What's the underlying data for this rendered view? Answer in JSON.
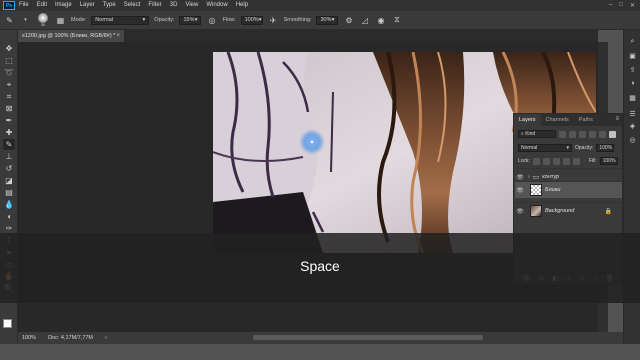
{
  "menu": {
    "logo": "Ps",
    "items": [
      "File",
      "Edit",
      "Image",
      "Layer",
      "Type",
      "Select",
      "Filter",
      "3D",
      "View",
      "Window",
      "Help"
    ],
    "window_controls": [
      "–",
      "□",
      "✕"
    ]
  },
  "options": {
    "brush_size": "30",
    "mode_label": "Mode:",
    "mode_value": "Normal",
    "opacity_label": "Opacity:",
    "opacity_value": "15%",
    "flow_label": "Flow:",
    "flow_value": "100%",
    "smoothing_label": "Smoothing:",
    "smoothing_value": "30%"
  },
  "document": {
    "tab_title": "s1200.jpg @ 100% (Блики, RGB/8#) *",
    "close": "×",
    "zoom": "100%",
    "doc_info": "Doc: 4,17M/7,77M"
  },
  "layers_panel": {
    "tabs": [
      "Layers",
      "Channels",
      "Paths"
    ],
    "menu_icon": "≡",
    "kind_label": "Kind",
    "blend_mode": "Normal",
    "opacity_label": "Opacity:",
    "opacity_value": "100%",
    "lock_label": "Lock:",
    "fill_label": "Fill:",
    "fill_value": "100%",
    "layers": [
      {
        "name": "контур",
        "type": "group"
      },
      {
        "name": "Блики",
        "type": "checker"
      },
      {
        "name": "Background",
        "type": "photo"
      }
    ],
    "footer_icons": [
      "⛓",
      "fx",
      "◧",
      "◐",
      "▭",
      "+",
      "🗑"
    ]
  },
  "overlay": {
    "caption": "Space"
  },
  "colors": {
    "brush_highlight": "#4a90e2",
    "panel_bg": "#3a3a3a",
    "canvas_bg": "#282828"
  }
}
